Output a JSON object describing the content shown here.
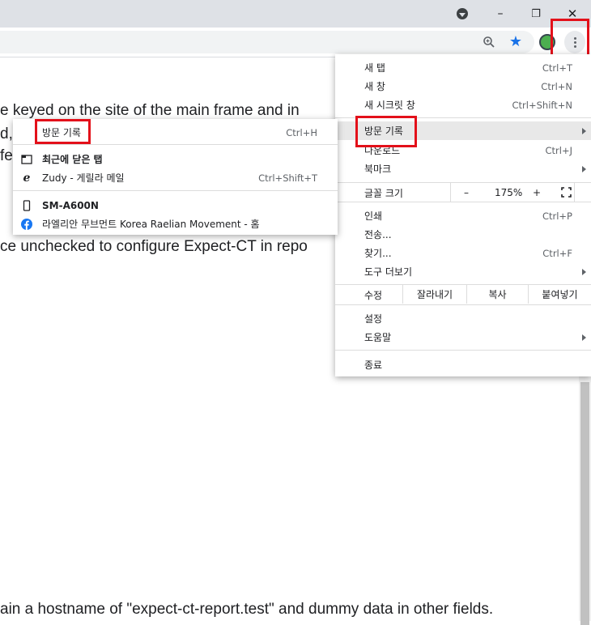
{
  "window": {
    "minimize_glyph": "–",
    "restore_glyph": "❐",
    "close_glyph": "✕"
  },
  "page": {
    "lines": [
      "e keyed on the site of the main frame and in",
      "d,",
      "fe",
      "ce unchecked to configure Expect-CT in repo",
      "ain a hostname of \"expect-ct-report.test\" and dummy data in other fields."
    ]
  },
  "menu": {
    "new_tab": {
      "label": "새 탭",
      "shortcut": "Ctrl+T"
    },
    "new_window": {
      "label": "새 창",
      "shortcut": "Ctrl+N"
    },
    "incognito": {
      "label": "새 시크릿 창",
      "shortcut": "Ctrl+Shift+N"
    },
    "history": {
      "label": "방문 기록"
    },
    "downloads": {
      "label": "다운로드",
      "shortcut": "Ctrl+J"
    },
    "bookmarks": {
      "label": "북마크"
    },
    "zoom": {
      "label": "글꼴 크기",
      "minus": "–",
      "value": "175%",
      "plus": "+"
    },
    "print": {
      "label": "인쇄",
      "shortcut": "Ctrl+P"
    },
    "cast": {
      "label": "전송..."
    },
    "find": {
      "label": "찾기...",
      "shortcut": "Ctrl+F"
    },
    "more_tools": {
      "label": "도구 더보기"
    },
    "edit": {
      "label": "수정",
      "cut": "잘라내기",
      "copy": "복사",
      "paste": "붙여넣기"
    },
    "settings": {
      "label": "설정"
    },
    "help": {
      "label": "도움말"
    },
    "exit": {
      "label": "종료"
    }
  },
  "history_submenu": {
    "history": {
      "label": "방문 기록",
      "shortcut": "Ctrl+H"
    },
    "recently_closed": {
      "label": "최근에 닫은 탭"
    },
    "zudy": {
      "label": "Zudy - 게릴라 메일",
      "shortcut": "Ctrl+Shift+T"
    },
    "device": {
      "label": "SM-A600N"
    },
    "facebook": {
      "label": "라엘리안 무브먼트 Korea Raelian Movement - 홈"
    }
  },
  "colors": {
    "highlight": "#e3101a",
    "accent": "#1a73e8",
    "facebook": "#1877f2"
  }
}
